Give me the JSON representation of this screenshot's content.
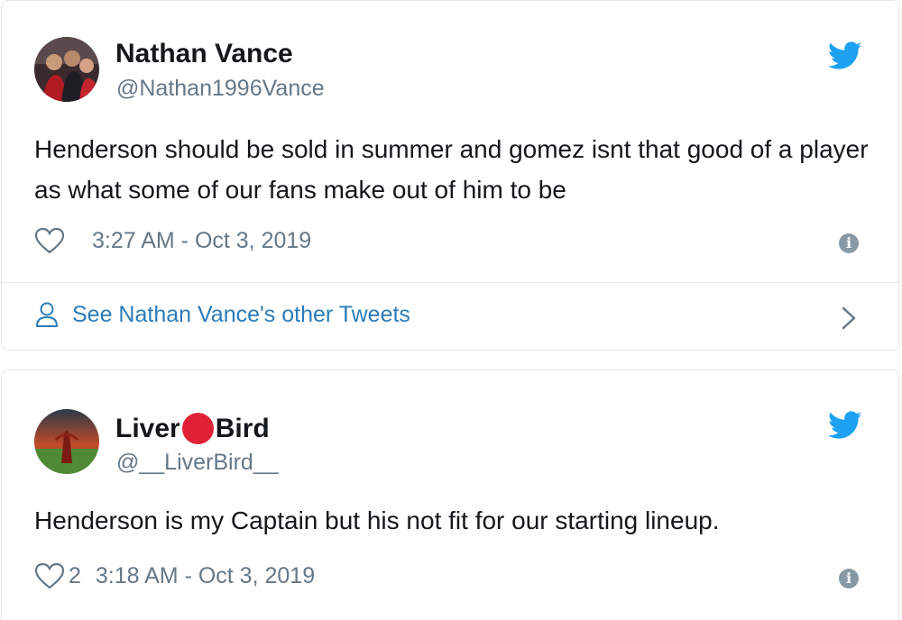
{
  "tweets": [
    {
      "name": "Nathan Vance",
      "handle": "@Nathan1996Vance",
      "text": "Henderson should be sold in summer and gomez isnt that good of a player as what some of our fans make out of him to be",
      "timestamp": "3:27 AM - Oct 3, 2019",
      "likes": "",
      "see_more": "See Nathan Vance's other Tweets",
      "avatar_icon": "avatar-photo-icon",
      "bird_icon": "twitter-bird-icon"
    },
    {
      "name_part1": "Liver",
      "name_part2": "Bird",
      "name_emoji": "red-circle-emoji",
      "handle": "@__LiverBird__",
      "text": "Henderson is my Captain but his not fit for our starting lineup.",
      "timestamp": "3:18 AM - Oct 3, 2019",
      "likes": "2",
      "avatar_icon": "avatar-photo-icon",
      "bird_icon": "twitter-bird-icon"
    }
  ],
  "colors": {
    "twitter_blue": "#1da1f2",
    "link_blue": "#2b7bb9",
    "text": "#14171a",
    "muted": "#657786",
    "border": "#e1e8ed",
    "emoji_red": "#e02035"
  }
}
